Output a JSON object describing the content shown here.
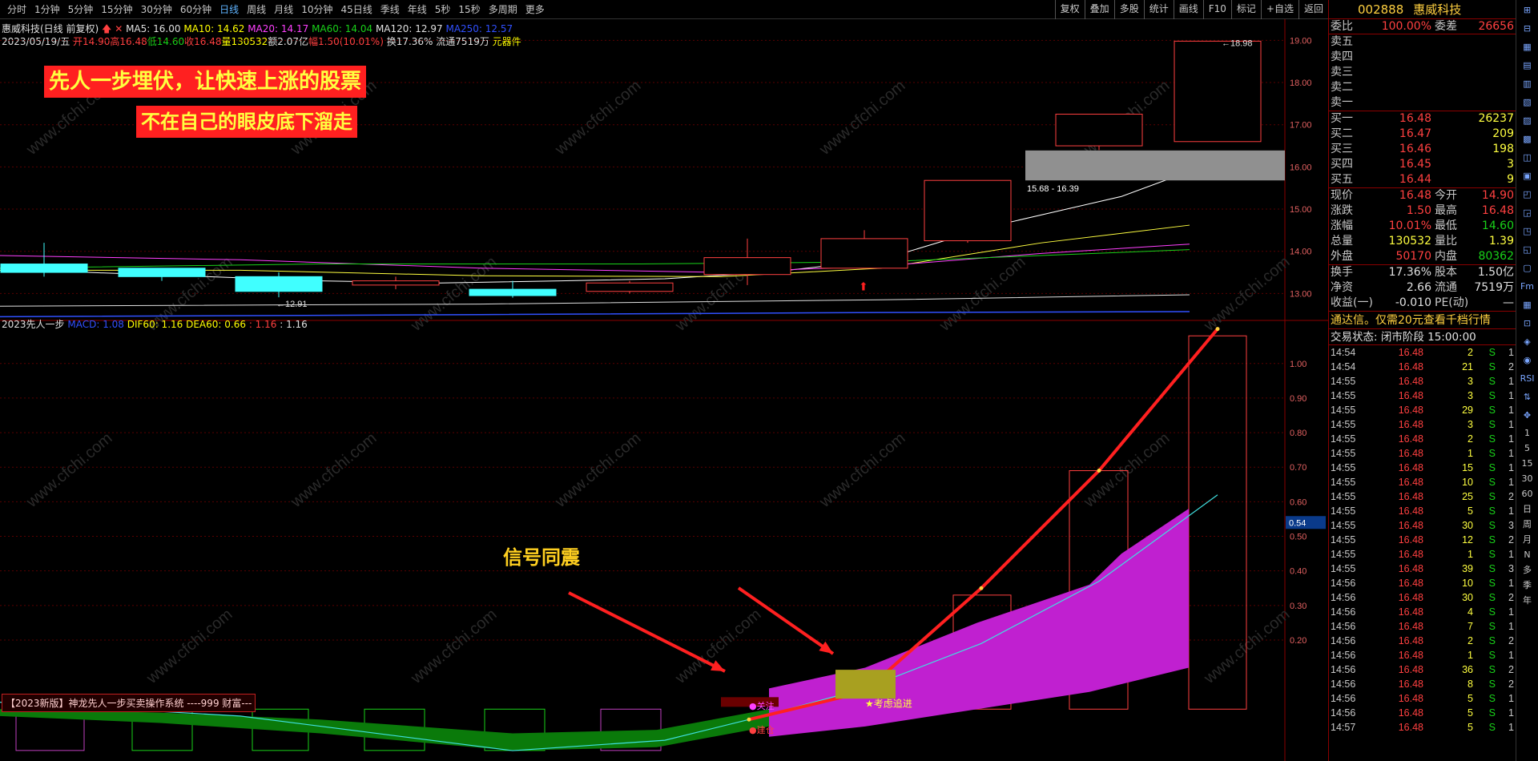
{
  "toolbar": {
    "periods": [
      "分时",
      "1分钟",
      "5分钟",
      "15分钟",
      "30分钟",
      "60分钟",
      "日线",
      "周线",
      "月线",
      "10分钟",
      "45日线",
      "季线",
      "年线",
      "5秒",
      "15秒",
      "多周期",
      "更多"
    ],
    "active": "日线",
    "tools": [
      "复权",
      "叠加",
      "多股",
      "统计",
      "画线",
      "F10",
      "标记",
      "+自选",
      "返回"
    ]
  },
  "header": {
    "name": "惠威科技(日线 前复权)",
    "ma": [
      "MA5: 16.00",
      "MA10: 14.62",
      "MA20: 14.17",
      "MA60: 14.04",
      "MA120: 12.97",
      "MA250: 12.57"
    ],
    "date": "2023/05/19/五",
    "open": "开14.90",
    "high": "高16.48",
    "low": "低14.60",
    "close": "收16.48",
    "vol": "量130532",
    "amt": "额2.07亿",
    "chg": "幅1.50(10.01%)",
    "turn": "换17.36%",
    "float": "流通7519万",
    "sector": "元器件"
  },
  "banners": {
    "line1": "先人一步埋伏，让快速上涨的股票",
    "line2": "不在自己的眼皮底下溜走",
    "signal": "信号同震"
  },
  "watermark": "www.cfchi.com",
  "upper_axis": {
    "ticks": [
      "19.00",
      "18.00",
      "17.00",
      "16.00",
      "15.00",
      "14.00",
      "13.00"
    ],
    "annot_high": "18.98",
    "annot_low": "12.91",
    "gap": "15.68 - 16.39"
  },
  "lower_axis": {
    "ticks": [
      "1.00",
      "0.90",
      "0.80",
      "0.70",
      "0.60",
      "0.50",
      "0.40",
      "0.30",
      "0.20"
    ],
    "cursor": "0.54"
  },
  "indicator": {
    "name": "2023先人一步",
    "macd": "MACD: 1.08",
    "dif": "DIF60: 1.16",
    "dea": "DEA60: 0.66",
    "v1": ": 1.16",
    "v2": ": 1.16",
    "tag_focus": "关注",
    "tag_build": "建仓",
    "tag_chase": "★考虑追进",
    "footer": "【2023新版】神龙先人一步买卖操作系统 ----999 财富---"
  },
  "chart_data": {
    "type": "candlestick",
    "candles": [
      {
        "o": 13.7,
        "c": 13.5,
        "h": 14.2,
        "l": 13.4
      },
      {
        "o": 13.6,
        "c": 13.4,
        "h": 13.6,
        "l": 13.3
      },
      {
        "o": 13.4,
        "c": 13.05,
        "h": 13.5,
        "l": 12.91
      },
      {
        "o": 13.2,
        "c": 13.3,
        "h": 13.4,
        "l": 13.1
      },
      {
        "o": 13.1,
        "c": 12.95,
        "h": 13.3,
        "l": 12.9
      },
      {
        "o": 13.05,
        "c": 13.25,
        "h": 13.3,
        "l": 13.0
      },
      {
        "o": 13.45,
        "c": 13.85,
        "h": 14.3,
        "l": 13.2
      },
      {
        "o": 13.6,
        "c": 14.3,
        "h": 14.5,
        "l": 13.6
      },
      {
        "o": 14.25,
        "c": 15.68,
        "h": 15.68,
        "l": 14.2
      },
      {
        "o": 16.5,
        "c": 17.25,
        "h": 17.25,
        "l": 16.4
      },
      {
        "o": 16.6,
        "c": 18.98,
        "h": 18.98,
        "l": 16.6
      }
    ],
    "ylim": [
      12.4,
      19.5
    ],
    "indicator_ylim": [
      -0.15,
      1.12
    ]
  },
  "quote": {
    "code": "002888",
    "name": "惠威科技",
    "webi_label": "委比",
    "webi": "100.00%",
    "wecha_label": "委差",
    "wecha": "26656",
    "sell": [
      {
        "l": "卖五",
        "p": "",
        "v": ""
      },
      {
        "l": "卖四",
        "p": "",
        "v": ""
      },
      {
        "l": "卖三",
        "p": "",
        "v": ""
      },
      {
        "l": "卖二",
        "p": "",
        "v": ""
      },
      {
        "l": "卖一",
        "p": "",
        "v": ""
      }
    ],
    "buy": [
      {
        "l": "买一",
        "p": "16.48",
        "v": "26237"
      },
      {
        "l": "买二",
        "p": "16.47",
        "v": "209"
      },
      {
        "l": "买三",
        "p": "16.46",
        "v": "198"
      },
      {
        "l": "买四",
        "p": "16.45",
        "v": "3"
      },
      {
        "l": "买五",
        "p": "16.44",
        "v": "9"
      }
    ],
    "stats": [
      {
        "a": "现价",
        "b": "16.48",
        "c": "今开",
        "d": "14.90",
        "bc": "#ff4040",
        "dc": "#ff4040"
      },
      {
        "a": "涨跌",
        "b": "1.50",
        "c": "最高",
        "d": "16.48",
        "bc": "#ff4040",
        "dc": "#ff4040"
      },
      {
        "a": "涨幅",
        "b": "10.01%",
        "c": "最低",
        "d": "14.60",
        "bc": "#ff4040",
        "dc": "#19d219"
      },
      {
        "a": "总量",
        "b": "130532",
        "c": "量比",
        "d": "1.39",
        "bc": "#ffff40",
        "dc": "#ffff40"
      },
      {
        "a": "外盘",
        "b": "50170",
        "c": "内盘",
        "d": "80362",
        "bc": "#ff4040",
        "dc": "#19d219"
      }
    ],
    "fund": [
      {
        "a": "换手",
        "b": "17.36%",
        "c": "股本",
        "d": "1.50亿"
      },
      {
        "a": "净资",
        "b": "2.66",
        "c": "流通",
        "d": "7519万"
      },
      {
        "a": "收益(一)",
        "b": "-0.010",
        "c": "PE(动)",
        "d": "—"
      }
    ],
    "promo": "通达信。仅需20元查看千档行情",
    "status": "交易状态: 闭市阶段 15:00:00"
  },
  "ticks": [
    [
      "14:54",
      "16.48",
      "2",
      "S",
      "1"
    ],
    [
      "14:54",
      "16.48",
      "21",
      "S",
      "2"
    ],
    [
      "14:55",
      "16.48",
      "3",
      "S",
      "1"
    ],
    [
      "14:55",
      "16.48",
      "3",
      "S",
      "1"
    ],
    [
      "14:55",
      "16.48",
      "29",
      "S",
      "1"
    ],
    [
      "14:55",
      "16.48",
      "3",
      "S",
      "1"
    ],
    [
      "14:55",
      "16.48",
      "2",
      "S",
      "1"
    ],
    [
      "14:55",
      "16.48",
      "1",
      "S",
      "1"
    ],
    [
      "14:55",
      "16.48",
      "15",
      "S",
      "1"
    ],
    [
      "14:55",
      "16.48",
      "10",
      "S",
      "1"
    ],
    [
      "14:55",
      "16.48",
      "25",
      "S",
      "2"
    ],
    [
      "14:55",
      "16.48",
      "5",
      "S",
      "1"
    ],
    [
      "14:55",
      "16.48",
      "30",
      "S",
      "3"
    ],
    [
      "14:55",
      "16.48",
      "12",
      "S",
      "2"
    ],
    [
      "14:55",
      "16.48",
      "1",
      "S",
      "1"
    ],
    [
      "14:55",
      "16.48",
      "39",
      "S",
      "3"
    ],
    [
      "14:56",
      "16.48",
      "10",
      "S",
      "1"
    ],
    [
      "14:56",
      "16.48",
      "30",
      "S",
      "2"
    ],
    [
      "14:56",
      "16.48",
      "4",
      "S",
      "1"
    ],
    [
      "14:56",
      "16.48",
      "7",
      "S",
      "1"
    ],
    [
      "14:56",
      "16.48",
      "2",
      "S",
      "2"
    ],
    [
      "14:56",
      "16.48",
      "1",
      "S",
      "1"
    ],
    [
      "14:56",
      "16.48",
      "36",
      "S",
      "2"
    ],
    [
      "14:56",
      "16.48",
      "8",
      "S",
      "2"
    ],
    [
      "14:56",
      "16.48",
      "5",
      "S",
      "1"
    ],
    [
      "14:56",
      "16.48",
      "5",
      "S",
      "1"
    ],
    [
      "14:57",
      "16.48",
      "5",
      "S",
      "1"
    ]
  ],
  "sidebar": {
    "labels": [
      "1",
      "5",
      "15",
      "30",
      "60",
      "日",
      "周",
      "月",
      "N",
      "多",
      "季",
      "年"
    ]
  }
}
